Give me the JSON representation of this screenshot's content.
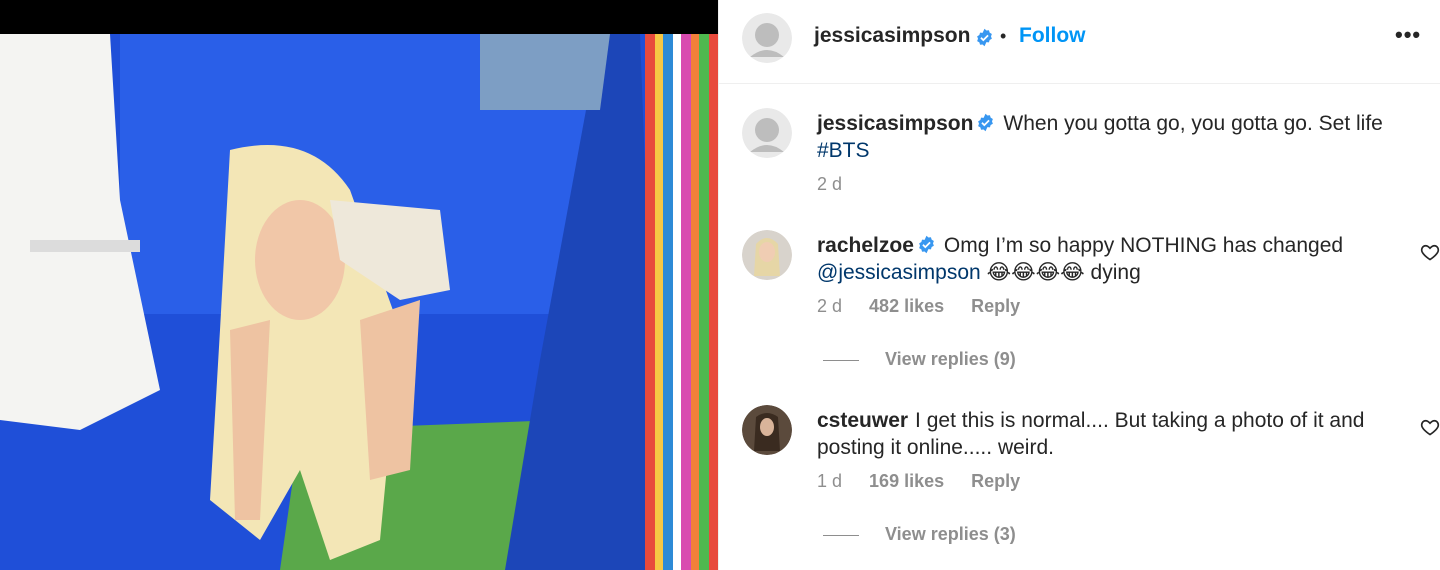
{
  "post": {
    "author": "jessicasimpson",
    "follow_label": "Follow",
    "separator": "•",
    "more_label": "•••",
    "caption": {
      "author": "jessicasimpson",
      "text": "When you gotta go, you gotta go. Set life",
      "hashtag": "#BTS",
      "time": "2 d"
    }
  },
  "comments": [
    {
      "author": "rachelzoe",
      "text_before": "Omg I’m so happy NOTHING has changed",
      "mention": "@jessicasimpson",
      "text_after": "😂😂😂😂 dying",
      "time": "2 d",
      "likes": "482 likes",
      "reply_label": "Reply",
      "view_replies": "View replies (9)"
    },
    {
      "author": "csteuwer",
      "text": "I get this is normal.... But taking a photo of it and posting it online..... weird.",
      "time": "1 d",
      "likes": "169 likes",
      "reply_label": "Reply",
      "view_replies": "View replies (3)"
    }
  ],
  "colors": {
    "link_blue": "#0095f6",
    "hashtag_blue": "#00376b",
    "verified_blue": "#3897f0",
    "muted_gray": "#8e8e8e"
  }
}
